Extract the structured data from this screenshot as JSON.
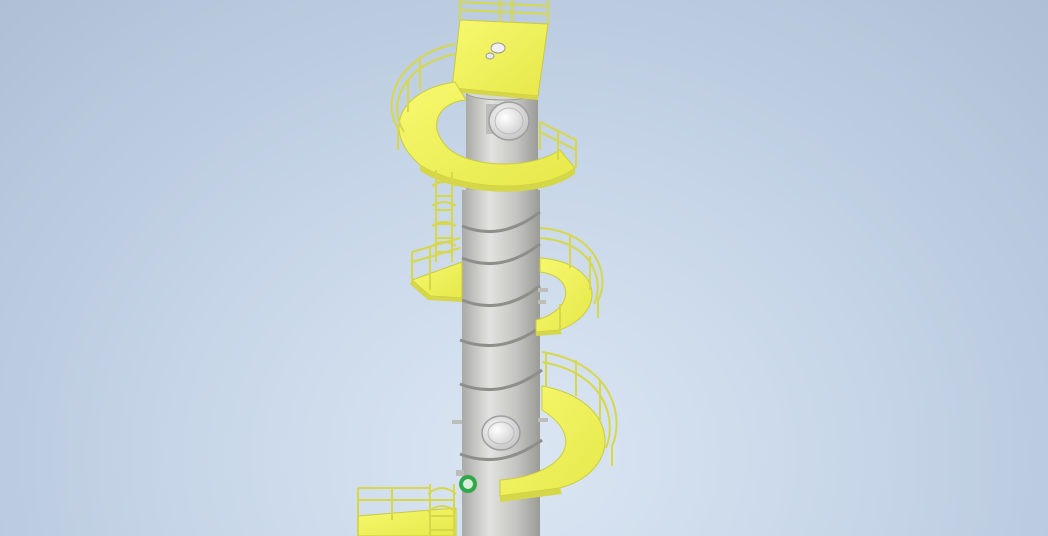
{
  "viewport": {
    "background_top": "#aebfd6",
    "background_center": "#dbe6f3"
  },
  "model": {
    "shell_color": "#c9c9c6",
    "platform_color": "#f1f35c",
    "railing_color": "#d6d84a",
    "nozzle_accent_color": "#2fa84a",
    "components": [
      "column-shell",
      "top-platform",
      "spiral-platform-upper",
      "spiral-platform-middle",
      "spiral-platform-lower",
      "bottom-platform",
      "access-ladder",
      "manway-top",
      "manway-bottom",
      "green-nozzle"
    ]
  }
}
